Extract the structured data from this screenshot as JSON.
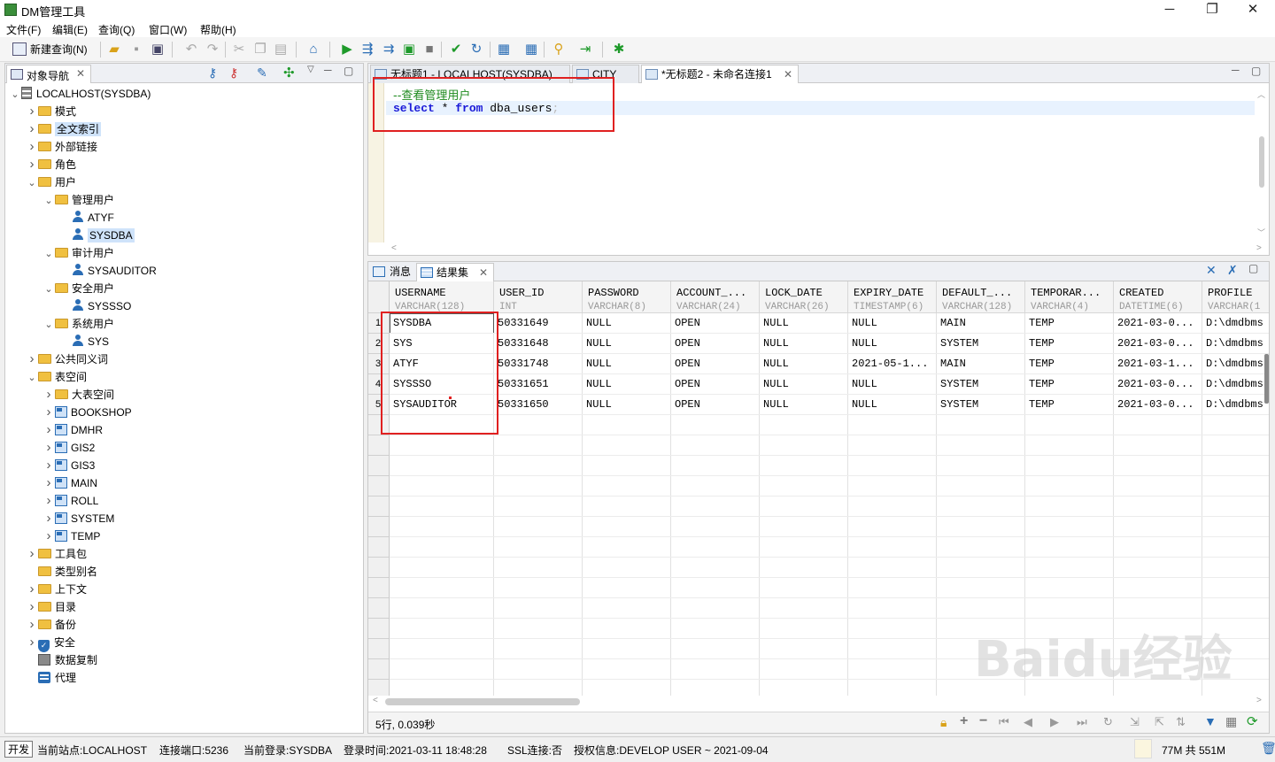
{
  "window": {
    "title": "DM管理工具",
    "minimize": "─",
    "maximize": "❐",
    "close": "✕"
  },
  "menu": [
    "文件(F)",
    "编辑(E)",
    "查询(Q)",
    "窗口(W)",
    "帮助(H)"
  ],
  "toolbar": {
    "new_query": "新建查询(N)"
  },
  "nav": {
    "tab_label": "对象导航",
    "tree": [
      {
        "label": "LOCALHOST(SYSDBA)",
        "depth": 0,
        "icon": "server-icon",
        "arrow": "open"
      },
      {
        "label": "模式",
        "depth": 1,
        "icon": "folder-icon",
        "arrow": "closed"
      },
      {
        "label": "全文索引",
        "depth": 1,
        "icon": "folder-icon",
        "arrow": "closed",
        "highlight": true
      },
      {
        "label": "外部链接",
        "depth": 1,
        "icon": "folder-icon",
        "arrow": "closed"
      },
      {
        "label": "角色",
        "depth": 1,
        "icon": "folder-icon",
        "arrow": "closed"
      },
      {
        "label": "用户",
        "depth": 1,
        "icon": "folder-icon",
        "arrow": "open"
      },
      {
        "label": "管理用户",
        "depth": 2,
        "icon": "folder-icon",
        "arrow": "open"
      },
      {
        "label": "ATYF",
        "depth": 3,
        "icon": "user-icon",
        "arrow": "none"
      },
      {
        "label": "SYSDBA",
        "depth": 3,
        "icon": "user-icon",
        "arrow": "none",
        "selected": true
      },
      {
        "label": "审计用户",
        "depth": 2,
        "icon": "folder-icon",
        "arrow": "open"
      },
      {
        "label": "SYSAUDITOR",
        "depth": 3,
        "icon": "user-icon",
        "arrow": "none"
      },
      {
        "label": "安全用户",
        "depth": 2,
        "icon": "folder-icon",
        "arrow": "open"
      },
      {
        "label": "SYSSSO",
        "depth": 3,
        "icon": "user-icon",
        "arrow": "none"
      },
      {
        "label": "系统用户",
        "depth": 2,
        "icon": "folder-icon",
        "arrow": "open"
      },
      {
        "label": "SYS",
        "depth": 3,
        "icon": "user-icon",
        "arrow": "none"
      },
      {
        "label": "公共同义词",
        "depth": 1,
        "icon": "folder-icon",
        "arrow": "closed"
      },
      {
        "label": "表空间",
        "depth": 1,
        "icon": "folder-icon",
        "arrow": "open"
      },
      {
        "label": "大表空间",
        "depth": 2,
        "icon": "folder-icon",
        "arrow": "closed"
      },
      {
        "label": "BOOKSHOP",
        "depth": 2,
        "icon": "tablespace-icon",
        "arrow": "closed"
      },
      {
        "label": "DMHR",
        "depth": 2,
        "icon": "tablespace-icon",
        "arrow": "closed"
      },
      {
        "label": "GIS2",
        "depth": 2,
        "icon": "tablespace-icon",
        "arrow": "closed"
      },
      {
        "label": "GIS3",
        "depth": 2,
        "icon": "tablespace-icon",
        "arrow": "closed"
      },
      {
        "label": "MAIN",
        "depth": 2,
        "icon": "tablespace-icon",
        "arrow": "closed"
      },
      {
        "label": "ROLL",
        "depth": 2,
        "icon": "tablespace-icon",
        "arrow": "closed"
      },
      {
        "label": "SYSTEM",
        "depth": 2,
        "icon": "tablespace-icon",
        "arrow": "closed"
      },
      {
        "label": "TEMP",
        "depth": 2,
        "icon": "tablespace-icon",
        "arrow": "closed"
      },
      {
        "label": "工具包",
        "depth": 1,
        "icon": "folder-icon",
        "arrow": "closed"
      },
      {
        "label": "类型别名",
        "depth": 1,
        "icon": "folder-icon",
        "arrow": "none"
      },
      {
        "label": "上下文",
        "depth": 1,
        "icon": "folder-icon",
        "arrow": "closed"
      },
      {
        "label": "目录",
        "depth": 1,
        "icon": "folder-icon",
        "arrow": "closed"
      },
      {
        "label": "备份",
        "depth": 1,
        "icon": "folder-icon",
        "arrow": "closed"
      },
      {
        "label": "安全",
        "depth": 1,
        "icon": "shield-icon",
        "arrow": "closed"
      },
      {
        "label": "数据复制",
        "depth": 1,
        "icon": "replication-icon",
        "arrow": "none"
      },
      {
        "label": "代理",
        "depth": 1,
        "icon": "agent-icon",
        "arrow": "none"
      }
    ]
  },
  "editor": {
    "tabs": [
      "无标题1 - LOCALHOST(SYSDBA)",
      "CITY",
      "*无标题2 - 未命名连接1"
    ],
    "comment": "--查看管理用户",
    "kw_select": "select",
    "star": " * ",
    "kw_from": "from",
    "table": " dba_users",
    "semicolon": ";"
  },
  "results": {
    "tab_messages": "消息",
    "tab_resultset": "结果集",
    "columns": [
      {
        "name": "USERNAME",
        "type": "VARCHAR(128)"
      },
      {
        "name": "USER_ID",
        "type": "INT"
      },
      {
        "name": "PASSWORD",
        "type": "VARCHAR(8)"
      },
      {
        "name": "ACCOUNT_...",
        "type": "VARCHAR(24)"
      },
      {
        "name": "LOCK_DATE",
        "type": "VARCHAR(26)"
      },
      {
        "name": "EXPIRY_DATE",
        "type": "TIMESTAMP(6)"
      },
      {
        "name": "DEFAULT_...",
        "type": "VARCHAR(128)"
      },
      {
        "name": "TEMPORAR...",
        "type": "VARCHAR(4)"
      },
      {
        "name": "CREATED",
        "type": "DATETIME(6)"
      },
      {
        "name": "PROFILE",
        "type": "VARCHAR(1"
      }
    ],
    "rows": [
      [
        "SYSDBA",
        "50331649",
        "NULL",
        "OPEN",
        "NULL",
        "NULL",
        "MAIN",
        "TEMP",
        "2021-03-0...",
        "D:\\dmdbms"
      ],
      [
        "SYS",
        "50331648",
        "NULL",
        "OPEN",
        "NULL",
        "NULL",
        "SYSTEM",
        "TEMP",
        "2021-03-0...",
        "D:\\dmdbms"
      ],
      [
        "ATYF",
        "50331748",
        "NULL",
        "OPEN",
        "NULL",
        "2021-05-1...",
        "MAIN",
        "TEMP",
        "2021-03-1...",
        "D:\\dmdbms"
      ],
      [
        "SYSSSO",
        "50331651",
        "NULL",
        "OPEN",
        "NULL",
        "NULL",
        "SYSTEM",
        "TEMP",
        "2021-03-0...",
        "D:\\dmdbms"
      ],
      [
        "SYSAUDITOR",
        "50331650",
        "NULL",
        "OPEN",
        "NULL",
        "NULL",
        "SYSTEM",
        "TEMP",
        "2021-03-0...",
        "D:\\dmdbms"
      ]
    ],
    "row_numbers": [
      "1",
      "2",
      "3",
      "4",
      "5"
    ],
    "summary": "5行, 0.039秒"
  },
  "status": {
    "mode": "开发",
    "site": "当前站点:LOCALHOST",
    "port": "连接端口:5236",
    "login": "当前登录:SYSDBA",
    "login_time": "登录时间:2021-03-11 18:48:28",
    "ssl": "SSL连接:否",
    "license": "授权信息:DEVELOP USER ~ 2021-09-04",
    "memory": "77M 共 551M"
  },
  "watermark": "Baidu经验",
  "colors": {
    "keyword": "#1a1ad8",
    "comment": "#1f8a1f",
    "annotation_box": "#e02020",
    "selection": "#cfe3fa"
  }
}
